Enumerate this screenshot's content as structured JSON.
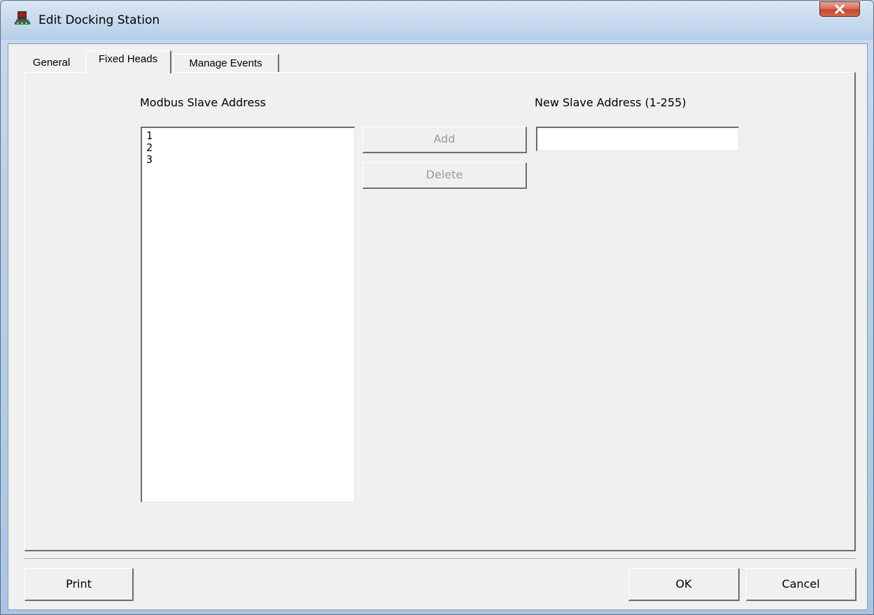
{
  "window": {
    "title": "Edit Docking Station",
    "close_glyph": "X"
  },
  "tabs": [
    {
      "label": "General",
      "active": false
    },
    {
      "label": "Fixed Heads",
      "active": true
    },
    {
      "label": "Manage Events",
      "active": false
    }
  ],
  "fixed_heads": {
    "list_label": "Modbus Slave Address",
    "items": [
      "1",
      "2",
      "3"
    ],
    "add_label": "Add",
    "delete_label": "Delete",
    "new_address_label": "New Slave Address (1-255)",
    "new_address_value": ""
  },
  "footer": {
    "print_label": "Print",
    "ok_label": "OK",
    "cancel_label": "Cancel"
  },
  "icons": {
    "title": "docking-station-icon",
    "close": "close-icon"
  }
}
